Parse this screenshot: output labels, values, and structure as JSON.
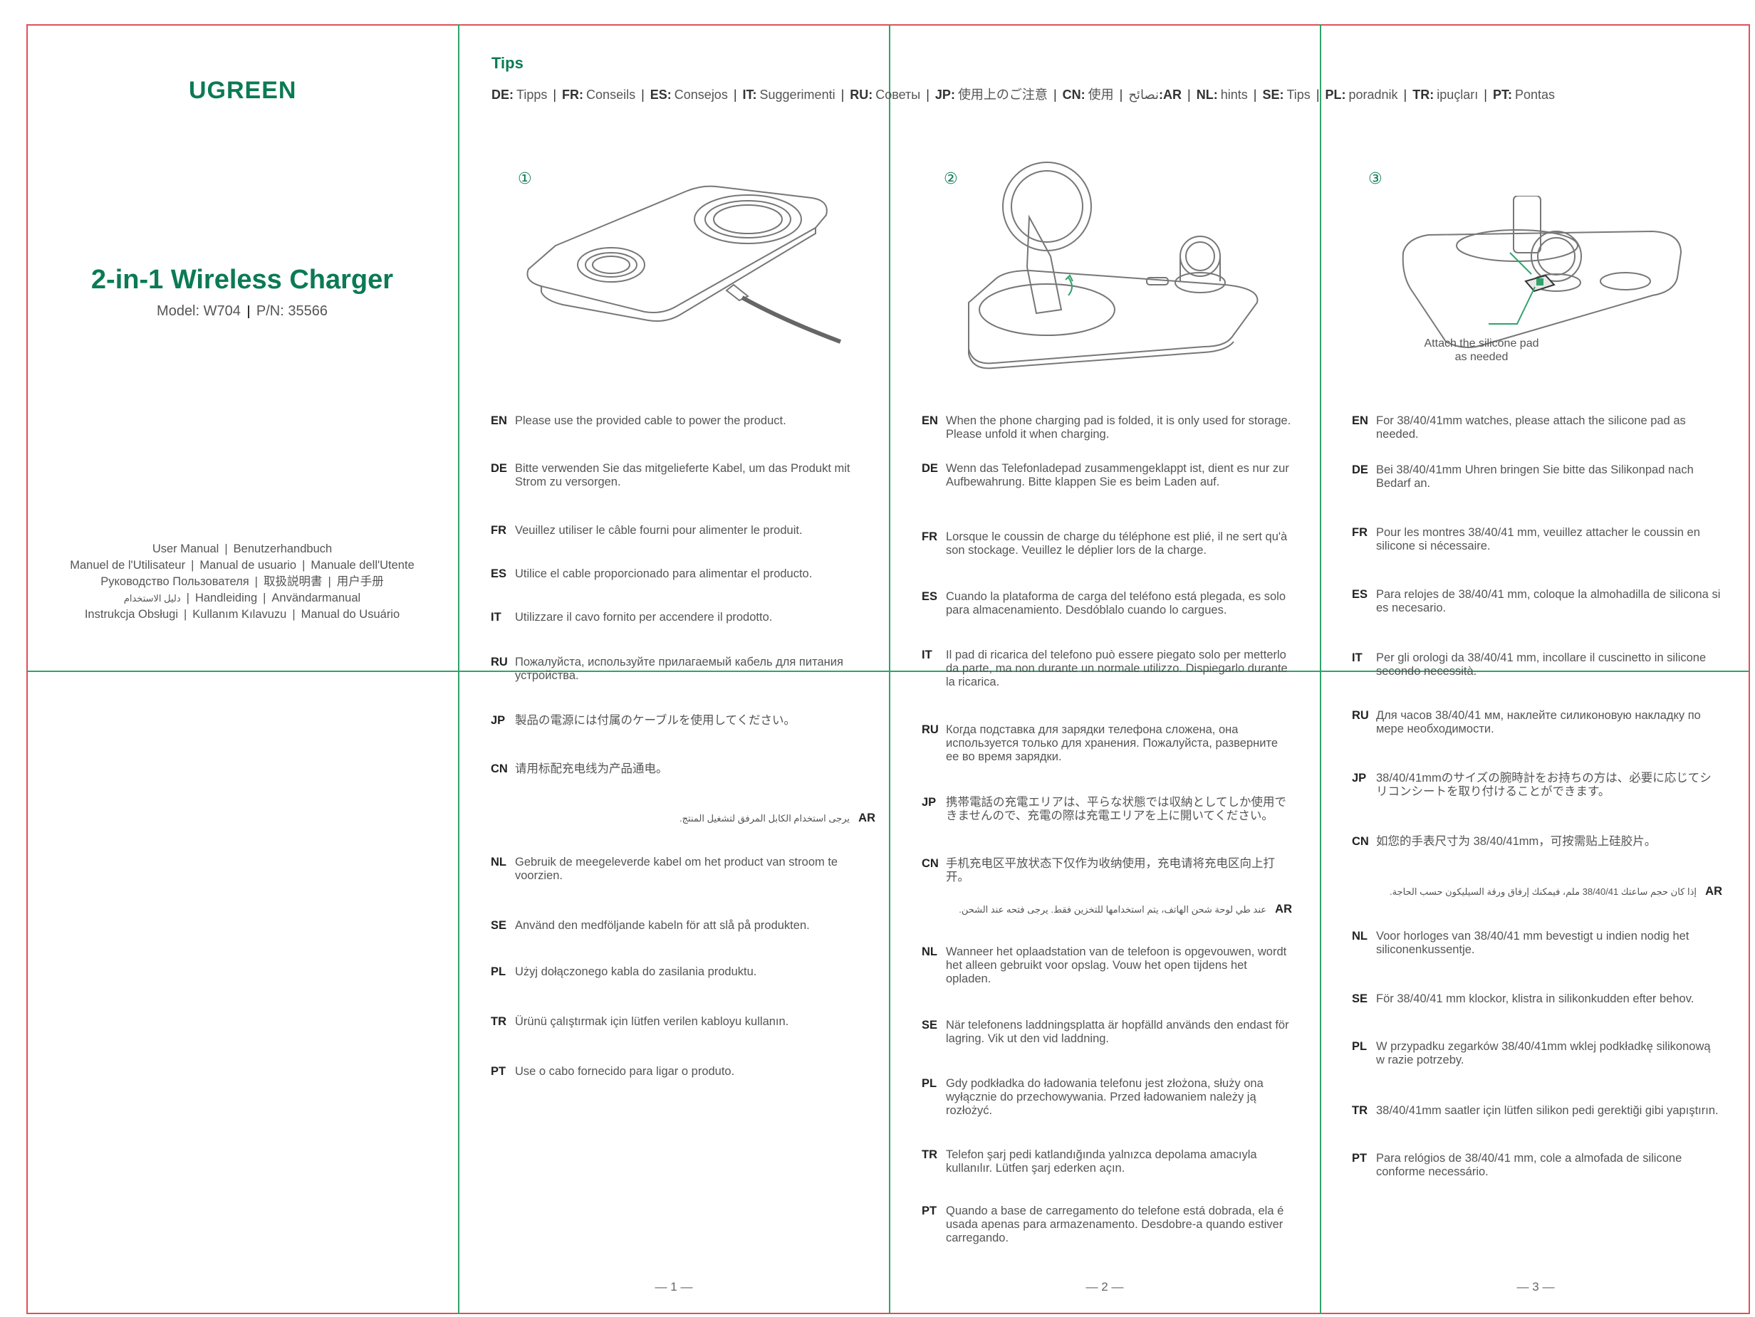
{
  "cover": {
    "logo": "UGREEN",
    "title": "2-in-1 Wireless Charger",
    "model": "Model: W704",
    "pn": "P/N: 35566",
    "manuals": [
      [
        "User Manual",
        "Benutzerhandbuch"
      ],
      [
        "Manuel de l'Utilisateur",
        "Manual de usuario",
        "Manuale dell'Utente"
      ],
      [
        "Руководство Пользователя",
        "取扱説明書",
        "用户手册"
      ],
      [
        "دليل الاستخدام",
        "Handleiding",
        "Användarmanual"
      ],
      [
        "Instrukcja Obsługi",
        "Kullanım Kılavuzu",
        "Manual do Usuário"
      ]
    ]
  },
  "tips": {
    "heading": "Tips",
    "langs": [
      {
        "code": "DE:",
        "word": "Tipps"
      },
      {
        "code": "FR:",
        "word": "Conseils"
      },
      {
        "code": "ES:",
        "word": "Consejos"
      },
      {
        "code": "IT:",
        "word": "Suggerimenti"
      },
      {
        "code": "RU:",
        "word": "Советы"
      },
      {
        "code": "JP:",
        "word": "使用上のご注意"
      },
      {
        "code": "CN:",
        "word": "使用"
      },
      {
        "code": ":AR",
        "word": "نصائح"
      },
      {
        "code": "NL:",
        "word": "hints"
      },
      {
        "code": "SE:",
        "word": "Tips"
      },
      {
        "code": "PL:",
        "word": "poradnik"
      },
      {
        "code": "TR:",
        "word": "ipuçları"
      },
      {
        "code": "PT:",
        "word": "Pontas"
      }
    ]
  },
  "steps": {
    "s1": "①",
    "s2": "②",
    "s3": "③"
  },
  "step3_note": {
    "line1": "Attach the silicone pad",
    "line2": "as needed"
  },
  "col1": [
    {
      "code": "EN",
      "text": "Please use the provided cable to power the product."
    },
    {
      "code": "DE",
      "text": "Bitte verwenden Sie das mitgelieferte Kabel, um das Produkt mit Strom zu versorgen."
    },
    {
      "code": "FR",
      "text": "Veuillez utiliser le câble fourni pour alimenter le produit."
    },
    {
      "code": "ES",
      "text": "Utilice el cable proporcionado para alimentar el producto."
    },
    {
      "code": "IT",
      "text": "Utilizzare il cavo fornito per accendere il prodotto."
    },
    {
      "code": "RU",
      "text": "Пожалуйста, используйте прилагаемый кабель для питания устройства."
    },
    {
      "code": "JP",
      "text": "製品の電源には付属のケーブルを使用してください。"
    },
    {
      "code": "CN",
      "text": "请用标配充电线为产品通电。"
    },
    {
      "code": "AR",
      "text": "يرجى استخدام الكابل المرفق لتشغيل المنتج."
    },
    {
      "code": "NL",
      "text": "Gebruik de meegeleverde kabel om het product van stroom te voorzien."
    },
    {
      "code": "SE",
      "text": "Använd den medföljande kabeln för att slå på produkten."
    },
    {
      "code": "PL",
      "text": "Użyj dołączonego kabla do zasilania produktu."
    },
    {
      "code": "TR",
      "text": "Ürünü çalıştırmak için lütfen verilen kabloyu kullanın."
    },
    {
      "code": "PT",
      "text": "Use o cabo fornecido para ligar o produto."
    }
  ],
  "col2": [
    {
      "code": "EN",
      "text": "When the phone charging pad is folded, it is only used for storage. Please unfold it when charging."
    },
    {
      "code": "DE",
      "text": "Wenn das Telefonladepad zusammengeklappt ist, dient es nur zur Aufbewahrung. Bitte klappen Sie es beim Laden auf."
    },
    {
      "code": "FR",
      "text": "Lorsque le coussin de charge du téléphone est plié, il ne sert qu'à son stockage. Veuillez le déplier lors de la charge."
    },
    {
      "code": "ES",
      "text": "Cuando la plataforma de carga del teléfono está plegada, es solo para almacenamiento. Desdóblalo cuando lo cargues."
    },
    {
      "code": "IT",
      "text": "Il pad di ricarica del telefono può essere piegato solo per metterlo da parte, ma non durante un normale utilizzo. Dispiegarlo durante la ricarica."
    },
    {
      "code": "RU",
      "text": "Когда подставка для зарядки телефона сложена, она используется только для хранения. Пожалуйста, разверните ее во время зарядки."
    },
    {
      "code": "JP",
      "text": "携帯電話の充電エリアは、平らな状態では収納としてしか使用できませんので、充電の際は充電エリアを上に開いてください。"
    },
    {
      "code": "CN",
      "text": "手机充电区平放状态下仅作为收纳使用，充电请将充电区向上打开。"
    },
    {
      "code": "AR",
      "text": "عند طي لوحة شحن الهاتف، يتم استخدامها للتخزين فقط. يرجى فتحه عند الشحن."
    },
    {
      "code": "NL",
      "text": "Wanneer het oplaadstation van de telefoon is opgevouwen, wordt het alleen gebruikt voor opslag. Vouw het open tijdens het opladen."
    },
    {
      "code": "SE",
      "text": "När telefonens laddningsplatta är hopfälld används den endast för lagring. Vik ut den vid laddning."
    },
    {
      "code": "PL",
      "text": "Gdy podkładka do ładowania telefonu jest złożona, służy ona wyłącznie do przechowywania. Przed ładowaniem należy ją rozłożyć."
    },
    {
      "code": "TR",
      "text": "Telefon şarj pedi katlandığında yalnızca depolama amacıyla kullanılır. Lütfen şarj ederken açın."
    },
    {
      "code": "PT",
      "text": "Quando a base de carregamento do telefone está dobrada, ela é usada apenas para armazenamento. Desdobre-a quando estiver carregando."
    }
  ],
  "col3": [
    {
      "code": "EN",
      "text": "For 38/40/41mm watches, please attach the silicone pad as needed."
    },
    {
      "code": "DE",
      "text": "Bei 38/40/41mm Uhren bringen Sie bitte das Silikonpad nach Bedarf an."
    },
    {
      "code": "FR",
      "text": "Pour les montres 38/40/41 mm, veuillez attacher le coussin en silicone si nécessaire."
    },
    {
      "code": "ES",
      "text": "Para relojes de 38/40/41 mm, coloque la almohadilla de silicona si es necesario."
    },
    {
      "code": "IT",
      "text": "Per gli orologi da 38/40/41 mm, incollare il cuscinetto in silicone secondo necessità."
    },
    {
      "code": "RU",
      "text": "Для часов 38/40/41 мм, наклейте силиконовую накладку по мере необходимости."
    },
    {
      "code": "JP",
      "text": "38/40/41mmのサイズの腕時計をお持ちの方は、必要に応じてシリコンシートを取り付けることができます。"
    },
    {
      "code": "CN",
      "text": "如您的手表尺寸为 38/40/41mm，可按需贴上硅胶片。"
    },
    {
      "code": "AR",
      "text": "إذا كان حجم ساعتك 38/40/41 ملم، فيمكنك إرفاق ورقة السيليكون حسب الحاجة."
    },
    {
      "code": "NL",
      "text": "Voor horloges van 38/40/41 mm bevestigt u indien nodig het siliconenkussentje."
    },
    {
      "code": "SE",
      "text": "För 38/40/41 mm klockor, klistra in silikonkudden efter behov."
    },
    {
      "code": "PL",
      "text": "W przypadku zegarków 38/40/41mm wklej podkładkę silikonową w razie potrzeby."
    },
    {
      "code": "TR",
      "text": "38/40/41mm saatler için lütfen silikon pedi gerektiği gibi yapıştırın."
    },
    {
      "code": "PT",
      "text": "Para relógios de 38/40/41 mm, cole a almofada de silicone conforme necessário."
    }
  ],
  "pages": {
    "p1": "— 1 —",
    "p2": "— 2 —",
    "p3": "— 3 —"
  },
  "colors": {
    "brand": "#0b7a55",
    "frame": "#e0505a",
    "guides": "#2fa36b"
  }
}
